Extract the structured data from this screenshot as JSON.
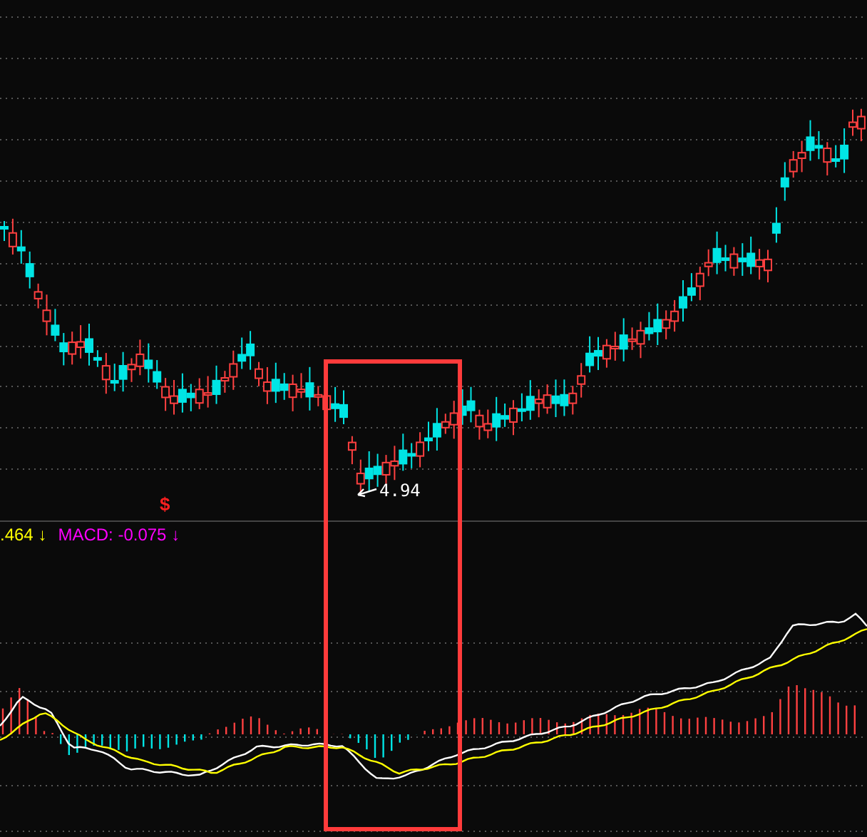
{
  "price_chart": {
    "low_price_label": "4.94",
    "signal_mark": "$"
  },
  "indicator_bar": {
    "values": [
      {
        "text": ".464 ↓",
        "color": "#ffff00"
      },
      {
        "text": "MACD: -0.075 ↓",
        "color": "#ff00ff"
      }
    ]
  }
}
